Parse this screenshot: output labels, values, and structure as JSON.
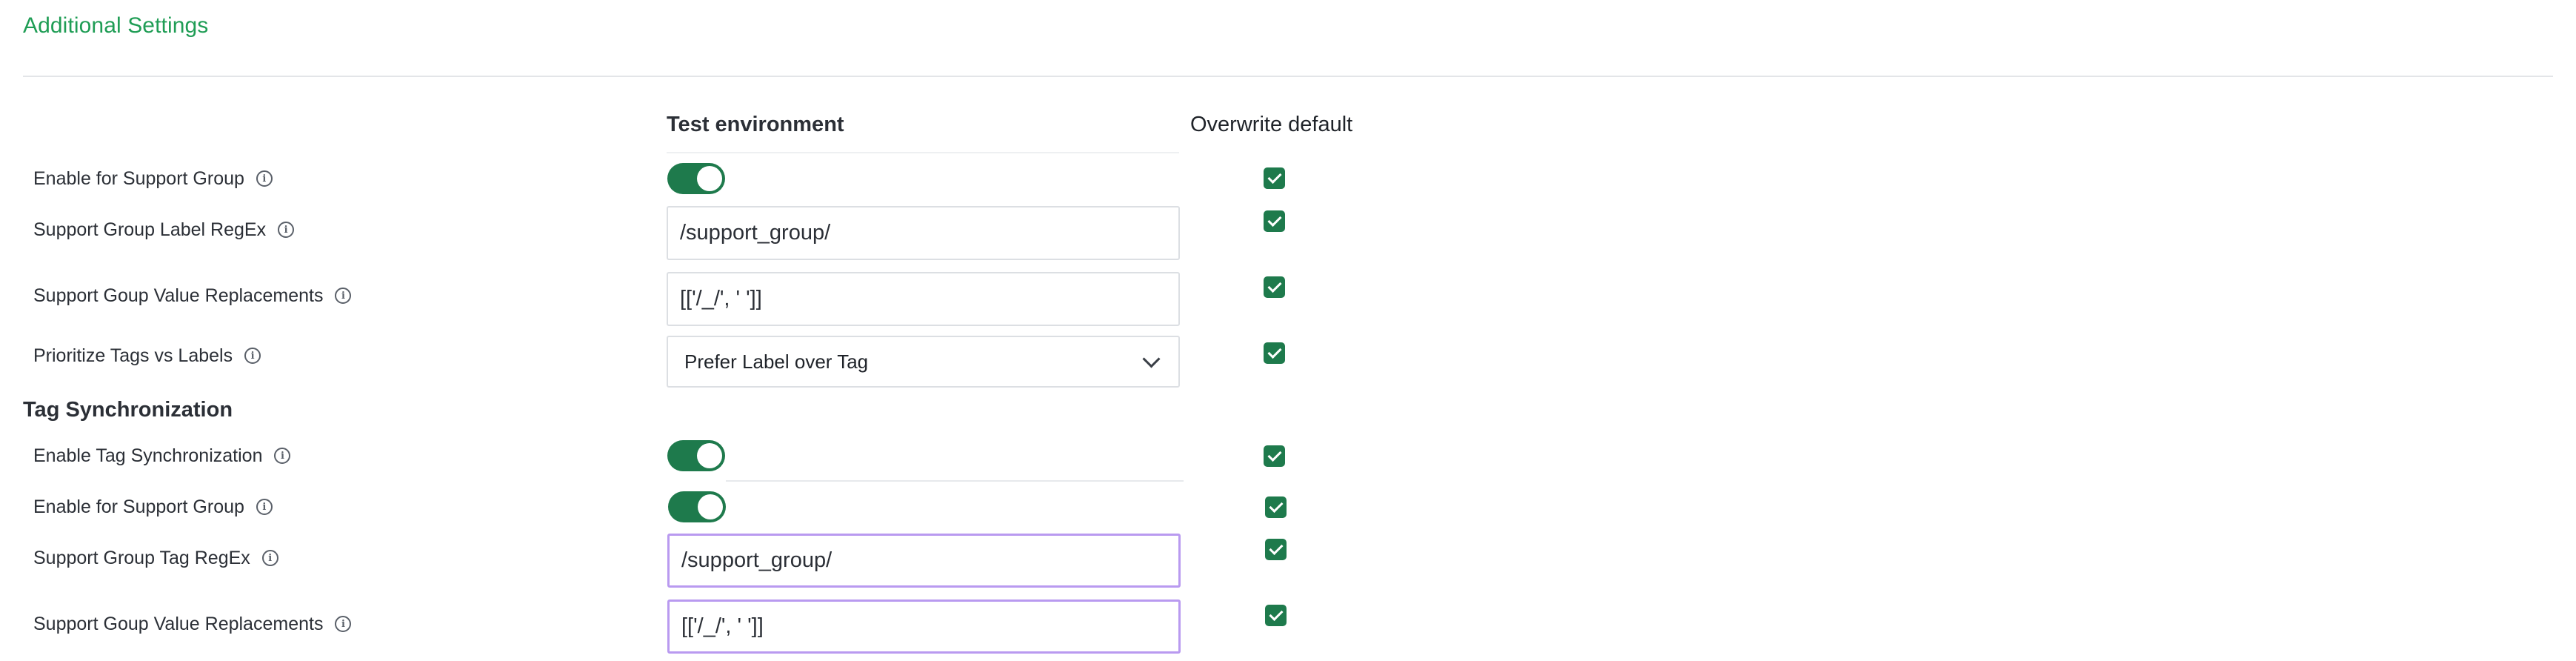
{
  "header": {
    "title": "Additional Settings",
    "col_test": "Test environment",
    "col_overwrite": "Overwrite default"
  },
  "support_group": {
    "enable_label": "Enable for Support Group",
    "enable_on": true,
    "enable_overwrite": true,
    "regex_label": "Support Group Label RegEx",
    "regex_value": "/support_group/",
    "regex_overwrite": true,
    "replacements_label": "Support Goup Value Replacements",
    "replacements_value": "[['/_/', ' ']]",
    "replacements_overwrite": true,
    "prioritize_label": "Prioritize Tags vs Labels",
    "prioritize_value": "Prefer Label over Tag",
    "prioritize_overwrite": true
  },
  "tag_sync": {
    "title": "Tag Synchronization",
    "enable_sync_label": "Enable Tag Synchronization",
    "enable_sync_on": true,
    "enable_sync_overwrite": true,
    "enable_group_label": "Enable for Support Group",
    "enable_group_on": true,
    "enable_group_overwrite": true,
    "regex_label": "Support Group Tag RegEx",
    "regex_value": "/support_group/",
    "regex_overwrite": true,
    "replacements_label": "Support Goup Value Replacements",
    "replacements_value": "[['/_/', ' ']]",
    "replacements_overwrite": true
  },
  "colors": {
    "accent_title": "#1f9d55",
    "toggle_on": "#1e7a4c",
    "checkbox": "#1e7a4c",
    "focus_border": "#b99af0"
  },
  "icons": {
    "info": "info-circle-icon",
    "check": "check-icon",
    "chevron": "chevron-down-icon"
  }
}
